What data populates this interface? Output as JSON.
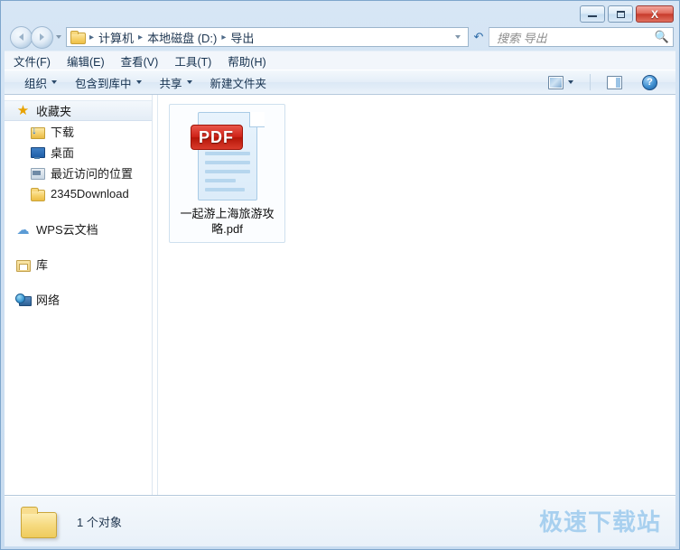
{
  "window": {
    "controls": {
      "minimize_label": "—",
      "maximize_label": "",
      "close_label": "X"
    }
  },
  "address": {
    "folder_icon": "folder-icon",
    "breadcrumbs": [
      "计算机",
      "本地磁盘 (D:)",
      "导出"
    ],
    "separator": "▸",
    "dropdown_icon": "chevron-down-icon",
    "refresh_icon": "refresh-icon"
  },
  "search": {
    "placeholder": "搜索 导出",
    "value": "",
    "icon": "search-icon"
  },
  "menubar": {
    "items": [
      {
        "label": "文件(F)"
      },
      {
        "label": "编辑(E)"
      },
      {
        "label": "查看(V)"
      },
      {
        "label": "工具(T)"
      },
      {
        "label": "帮助(H)"
      }
    ]
  },
  "toolbar": {
    "items": [
      {
        "label": "组织",
        "has_caret": true
      },
      {
        "label": "包含到库中",
        "has_caret": true
      },
      {
        "label": "共享",
        "has_caret": true
      },
      {
        "label": "新建文件夹",
        "has_caret": false
      }
    ],
    "right_icons": [
      {
        "name": "change-view-icon"
      },
      {
        "name": "chevron-down-icon"
      },
      {
        "name": "preview-pane-icon"
      },
      {
        "name": "help-icon",
        "label": "?"
      }
    ]
  },
  "sidebar": {
    "items": [
      {
        "label": "收藏夹",
        "icon": "star-icon",
        "level": 0,
        "selected": true
      },
      {
        "label": "下载",
        "icon": "downloads-folder-icon",
        "level": 1,
        "selected": false
      },
      {
        "label": "桌面",
        "icon": "desktop-icon",
        "level": 1,
        "selected": false
      },
      {
        "label": "最近访问的位置",
        "icon": "recent-places-icon",
        "level": 1,
        "selected": false
      },
      {
        "label": "2345Download",
        "icon": "folder-icon",
        "level": 1,
        "selected": false
      },
      {
        "label": "WPS云文档",
        "icon": "cloud-icon",
        "level": 0,
        "selected": false
      },
      {
        "label": "库",
        "icon": "library-icon",
        "level": 0,
        "selected": false
      },
      {
        "label": "网络",
        "icon": "network-icon",
        "level": 0,
        "selected": false
      }
    ]
  },
  "content": {
    "files": [
      {
        "name": "一起游上海旅游攻略.pdf",
        "type_badge": "PDF",
        "selected": true
      }
    ]
  },
  "statusbar": {
    "folder_icon": "folder-icon",
    "text": "1 个对象"
  },
  "watermark": {
    "text": "极速下载站"
  },
  "colors": {
    "frame": "#cfe0f2",
    "accent": "#3a6f9e",
    "close_button": "#c73b2c",
    "pdf_badge": "#cf2318",
    "watermark": "#a8d0ef"
  }
}
